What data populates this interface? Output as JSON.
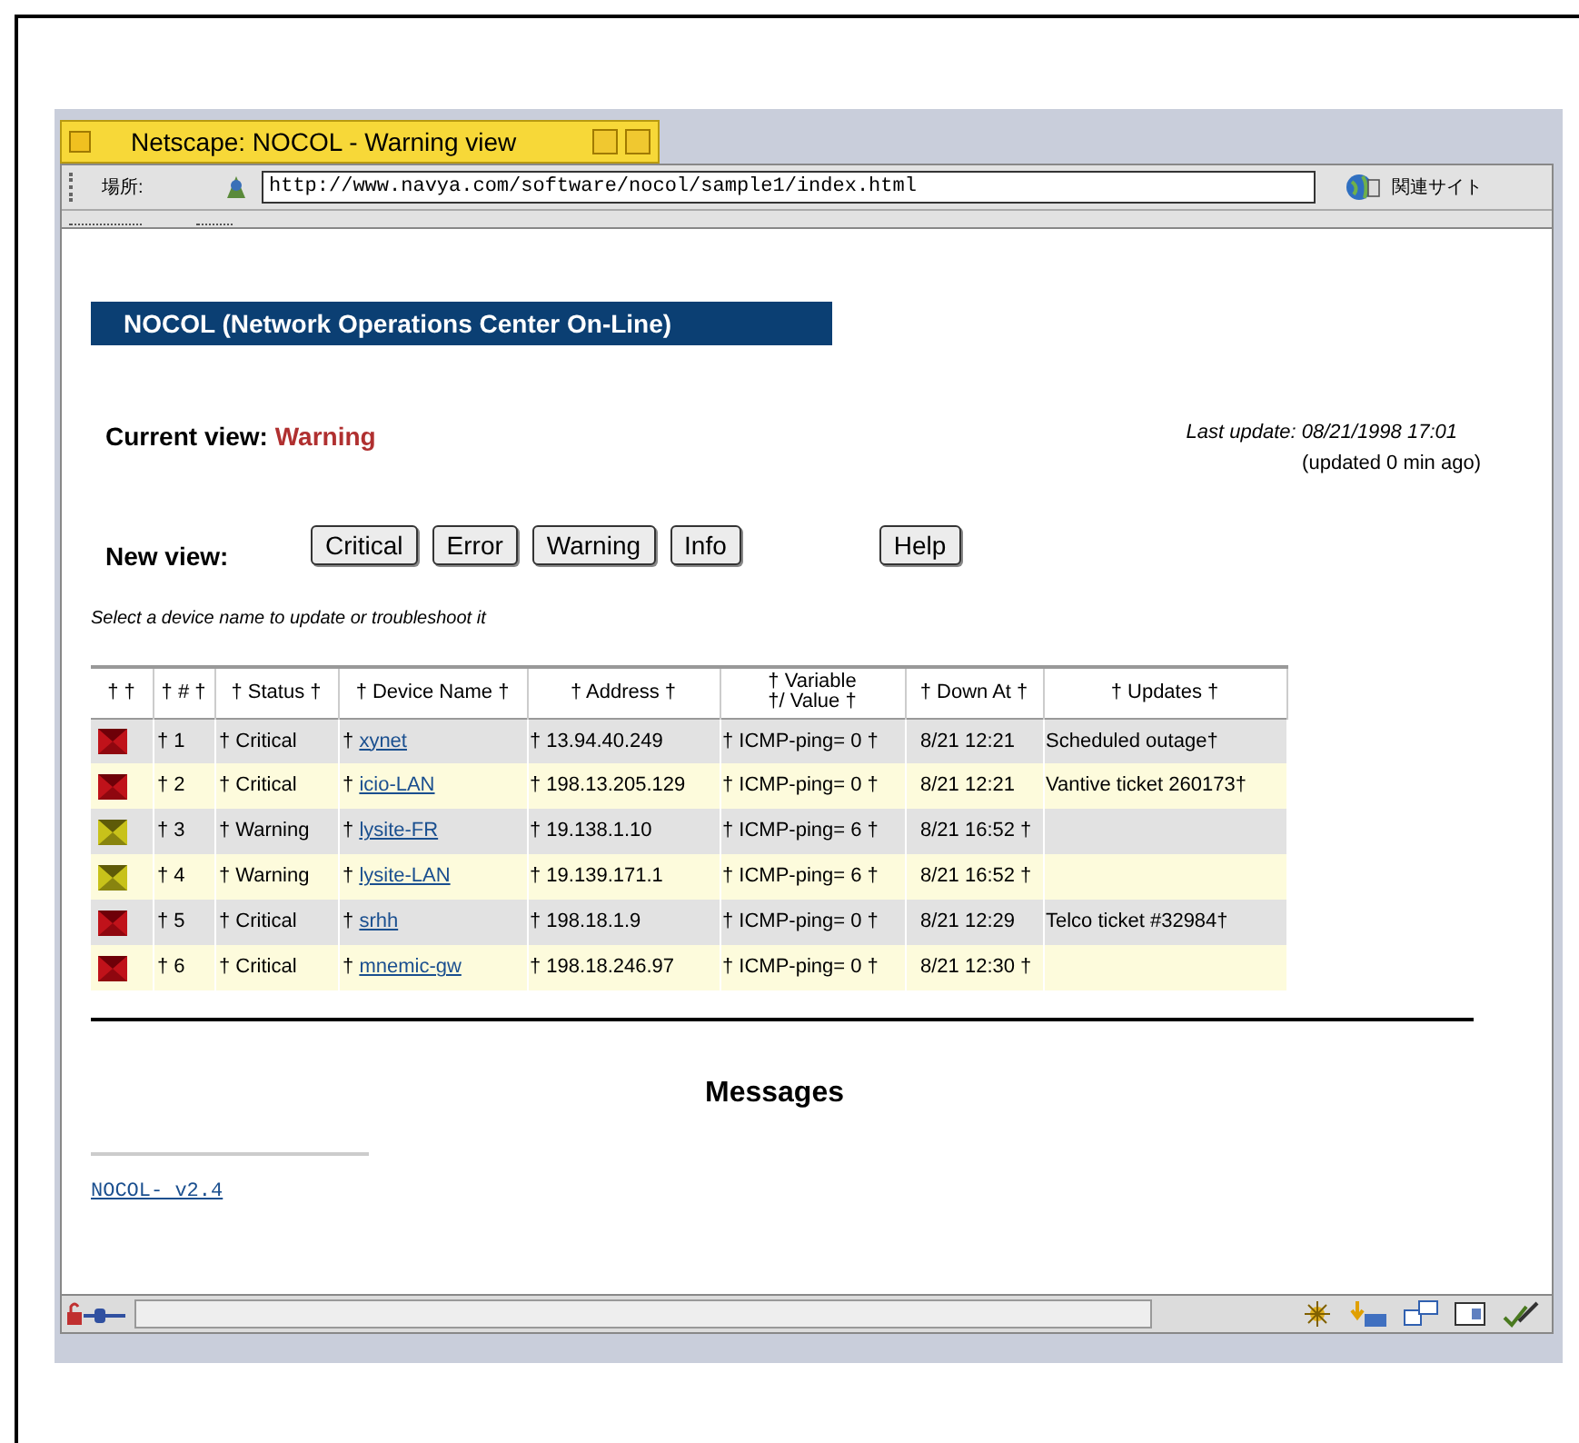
{
  "window": {
    "title": "Netscape: NOCOL - Warning view"
  },
  "toolbar": {
    "location_label": "場所:",
    "url": "http://www.navya.com/software/nocol/sample1/index.html",
    "related_label": "関連サイト"
  },
  "page": {
    "banner": "NOCOL (Network Operations Center On-Line)",
    "current_view_label": "Current view:",
    "current_view": "Warning",
    "last_update": "Last update: 08/21/1998 17:01",
    "updated_ago": "(updated 0 min ago)",
    "new_view_label": "New view:",
    "view_buttons": [
      "Critical",
      "Error",
      "Warning",
      "Info"
    ],
    "help_button": "Help",
    "instruction": "Select a device name to update or troubleshoot it"
  },
  "table": {
    "columns": [
      "† †",
      "† # †",
      "† Status †",
      "† Device Name †",
      "† Address †",
      "† Variable †/ Value †",
      "† Down At †",
      "† Updates †"
    ],
    "rows": [
      {
        "kind": "critical",
        "number": "† 1",
        "status": "† Critical",
        "device_prefix": "†",
        "device": "xynet",
        "address": "† 13.94.40.249",
        "variable": "† ICMP-ping= 0 †",
        "down_at": "8/21 12:21",
        "updates": "Scheduled outage†"
      },
      {
        "kind": "critical",
        "number": "† 2",
        "status": "† Critical",
        "device_prefix": "†",
        "device": "icio-LAN",
        "address": "† 198.13.205.129",
        "variable": "† ICMP-ping= 0 †",
        "down_at": "8/21 12:21",
        "updates": "Vantive ticket 260173†"
      },
      {
        "kind": "warning",
        "number": "† 3",
        "status": "† Warning",
        "device_prefix": "†",
        "device": "lysite-FR",
        "address": "† 19.138.1.10",
        "variable": "† ICMP-ping= 6 †",
        "down_at": "8/21 16:52 †"
      },
      {
        "kind": "warning",
        "number": "† 4",
        "status": "† Warning",
        "device_prefix": "†",
        "device": "lysite-LAN",
        "address": "† 19.139.171.1",
        "variable": "† ICMP-ping= 6 †",
        "down_at": "8/21 16:52 †"
      },
      {
        "kind": "critical",
        "number": "† 5",
        "status": "† Critical",
        "device_prefix": "†",
        "device": "srhh",
        "address": "† 198.18.1.9",
        "variable": "† ICMP-ping= 0 †",
        "down_at": "8/21 12:29",
        "updates": "Telco ticket #32984†"
      },
      {
        "kind": "critical",
        "number": "† 6",
        "status": "† Critical",
        "device_prefix": "†",
        "device": "mnemic-gw",
        "address": "† 198.18.246.97",
        "variable": "† ICMP-ping= 0 †",
        "down_at": "8/21 12:30 †"
      }
    ]
  },
  "messages": {
    "heading": "Messages",
    "footer_link": "NOCOL- v2.4"
  }
}
